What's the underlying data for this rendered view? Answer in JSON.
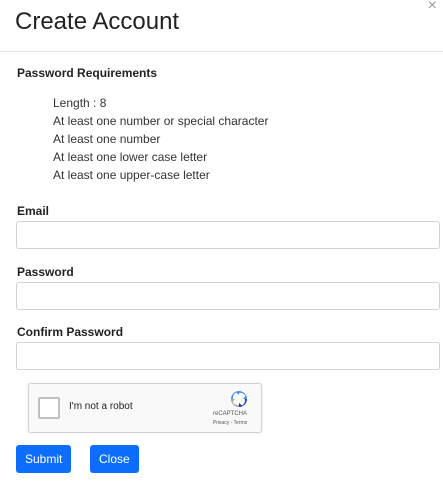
{
  "modal": {
    "title": "Create Account",
    "close_glyph": "×"
  },
  "requirements": {
    "title": "Password Requirements",
    "items": [
      "Length : 8",
      "At least one number or special character",
      "At least one number",
      "At least one lower case letter",
      "At least one upper-case letter"
    ]
  },
  "form": {
    "email_label": "Email",
    "email_value": "",
    "password_label": "Password",
    "password_value": "",
    "confirm_label": "Confirm Password",
    "confirm_value": ""
  },
  "recaptcha": {
    "label": "I'm not a robot",
    "brand": "reCAPTCHA",
    "terms": "Privacy - Terms",
    "icon": "recaptcha-logo"
  },
  "buttons": {
    "submit": "Submit",
    "close": "Close"
  },
  "colors": {
    "primary": "#0d6efd",
    "recaptcha_blue": "#1c3aa9",
    "recaptcha_light": "#4a90e2"
  }
}
